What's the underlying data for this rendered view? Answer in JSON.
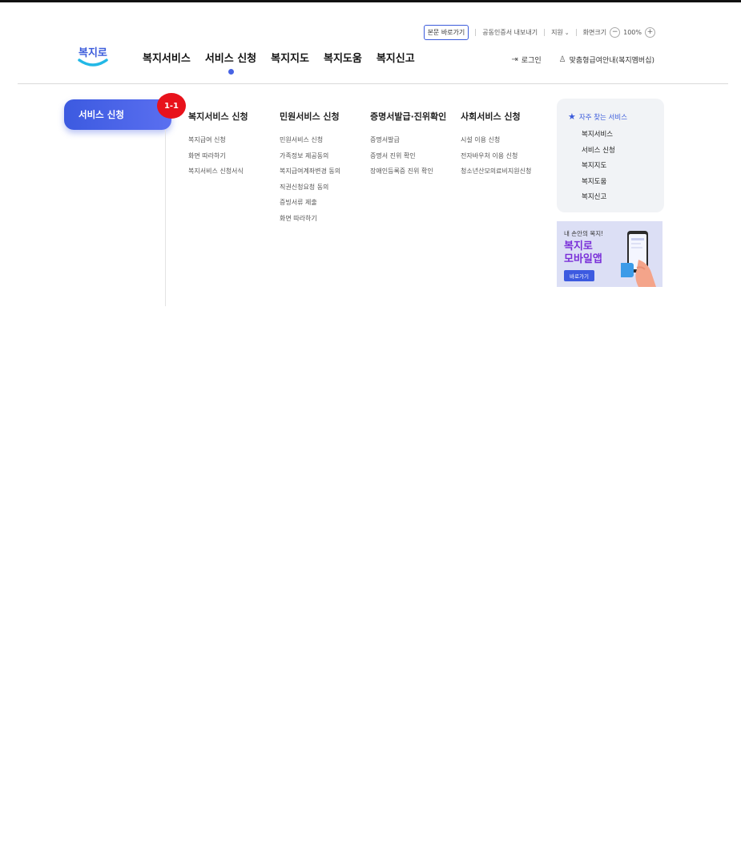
{
  "utility": {
    "skip_to_content": "본문 바로가기",
    "certificate_export": "공동인증서 내보내기",
    "support": "지원",
    "font_size_label": "화면크기",
    "zoom_level": "100%"
  },
  "logo_text": "복지로",
  "gnb": [
    "복지서비스",
    "서비스 신청",
    "복지지도",
    "복지도움",
    "복지신고"
  ],
  "user_links": {
    "login": "로그인",
    "membership": "맞춤형급여안내(복지멤버십)"
  },
  "submenu": {
    "section_title": "서비스 신청",
    "badge": "1-1",
    "columns": [
      {
        "title": "복지서비스 신청",
        "items": [
          "복지급여 신청",
          "화면 따라하기",
          "복지서비스 신청서식"
        ]
      },
      {
        "title": "민원서비스 신청",
        "items": [
          "민원서비스 신청",
          "가족정보 제공동의",
          "복지급여계좌변경 동의",
          "직권신청요청 동의",
          "증빙서류 제출",
          "화면 따라하기"
        ]
      },
      {
        "title": "증명서발급·진위확인",
        "items": [
          "증명서발급",
          "증명서 진위 확인",
          "장애인등록증 진위 확인"
        ]
      },
      {
        "title": "사회서비스 신청",
        "items": [
          "시설 이용 신청",
          "전자바우처 이용 신청",
          "청소년산모의료비지원신청"
        ]
      }
    ]
  },
  "favorites": {
    "title": "자주 찾는 서비스",
    "items": [
      "복지서비스",
      "서비스 신청",
      "복지지도",
      "복지도움",
      "복지신고"
    ]
  },
  "banner": {
    "line1": "내 손안의 복지!",
    "line2": "복지로",
    "line3": "모바일앱",
    "button": "바로가기"
  }
}
